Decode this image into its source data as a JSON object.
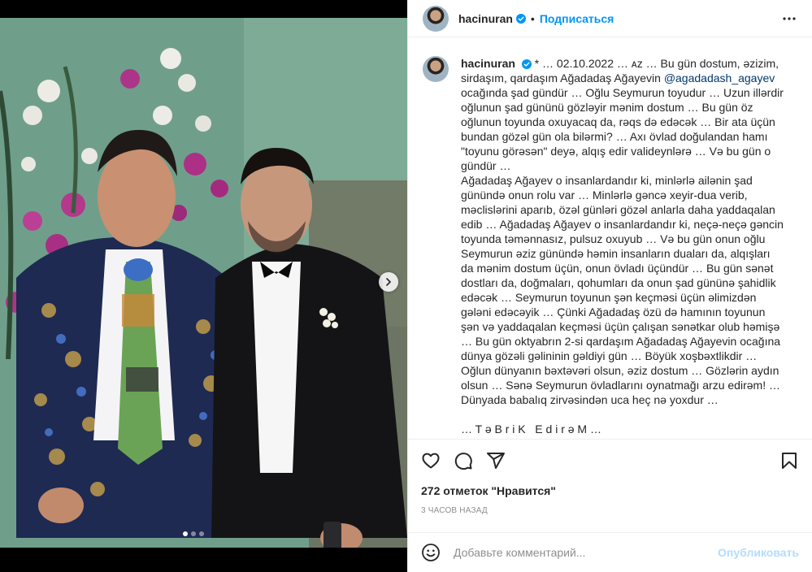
{
  "post": {
    "author": "hacinuran",
    "follow_label": "Подписаться",
    "header_separator": "•"
  },
  "caption": {
    "author": "hacinuran",
    "text_before_mention": "* … 02.10.2022 … ᴀᴢ … Bu gün dostum, əzizim, sirdaşım, qardaşım Ağadadaş Ağayevin ",
    "mention": "@agadadash_agayev",
    "text_after_mention": " ocağında şad gündür … Oğlu Seymurun toyudur … Uzun illərdir oğlunun şad gününü gözləyir mənim dostum … Bu gün öz oğlunun toyunda oxuyacaq da, rəqs də edəcək … Bir ata üçün bundan gözəl gün ola bilərmi? … Axı övlad doğulandan hamı \"toyunu görəsən\" deyə, alqış edir valideynlərə … Və bu gün o gündür …\nAğadadaş Ağayev o insanlardandır ki, minlərlə ailənin şad günündə onun rolu var … Minlərlə gəncə xeyir-dua verib, məclislərini aparıb, özəl günləri gözəl anlarla daha yaddaqalan edib … Ağadadaş Ağayev o insanlardandır ki, neçə-neçə gəncin toyunda təmənnasız, pulsuz oxuyub … Və bu gün onun oğlu Seymurun əziz günündə həmin insanların duaları da, alqışları da mənim dostum üçün, onun övladı üçündür … Bu gün sənət dostları da, doğmaları, qohumları da onun şad gününə şahidlik edəcək … Seymurun toyunun şən keçməsi üçün əlimizdən gələni edəcəyik … Çünki Ağadadaş özü də hamının toyunun şən və yaddaqalan keçməsi üçün çalışan sənətkar olub həmişə … Bu gün oktyabrın 2-si qardaşım Ağadadaş Ağayevin ocağına dünya gözəli gəlininin gəldiyi gün … Böyük xoşbəxtlikdir … Oğlun dünyanın bəxtəvəri olsun, əziz dostum … Gözlərin aydın olsun … Sənə Seymurun övladlarını oynatmağı arzu edirəm! … Dünyada babalıq zirvəsindən uca heç nə yoxdur …\n\n… T ə B r i K   E d i r ə M …"
  },
  "engagement": {
    "likes": "272 отметок \"Нравится\"",
    "time_ago": "3 часов назад"
  },
  "comment_box": {
    "placeholder": "Добавьте комментарий...",
    "publish_label": "Опубликовать"
  },
  "carousel": {
    "slide_count": 3,
    "active_slide": 1
  },
  "colors": {
    "accent": "#0095f6",
    "publish_disabled": "#b3dbff",
    "mention": "#00376b",
    "muted": "#8e8e8e"
  },
  "icons": [
    "verified-badge-icon",
    "more-options-icon",
    "heart-icon",
    "comment-icon",
    "share-icon",
    "bookmark-icon",
    "emoji-icon",
    "chevron-right-icon"
  ]
}
